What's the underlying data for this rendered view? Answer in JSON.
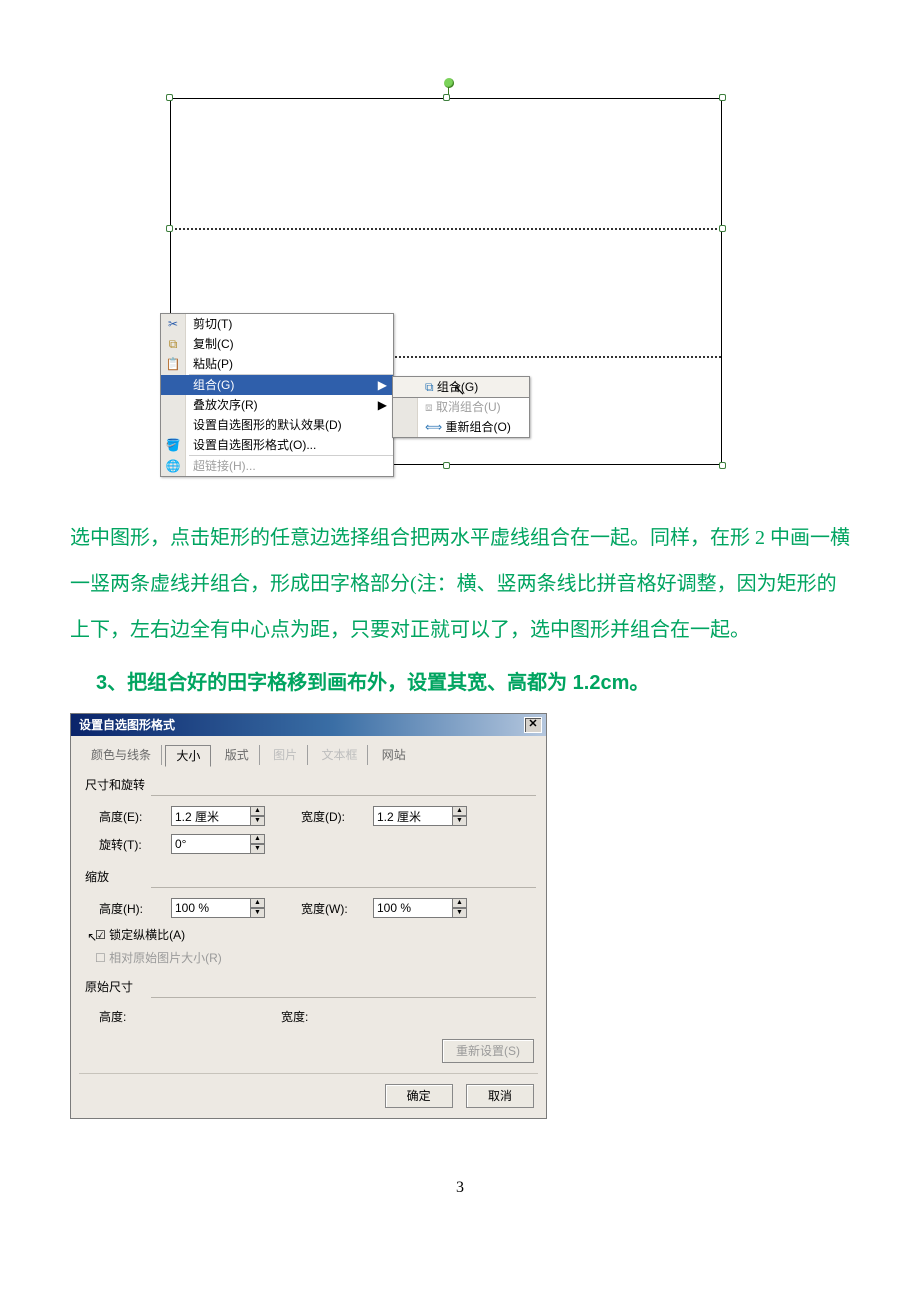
{
  "context_menu": {
    "cut": "剪切(T)",
    "copy": "复制(C)",
    "paste": "粘贴(P)",
    "group": "组合(G)",
    "order": "叠放次序(R)",
    "set_default": "设置自选图形的默认效果(D)",
    "format_shape": "设置自选图形格式(O)...",
    "hyperlink": "超链接(H)..."
  },
  "submenu": {
    "group": "组合(G)",
    "ungroup": "取消组合(U)",
    "regroup": "重新组合(O)"
  },
  "body": {
    "p1": "选中图形，点击矩形的任意边选择组合把两水平虚线组合在一起。同样，在形 2 中画一横一竖两条虚线并组合，形成田字格部分(注：横、竖两条线比拼音格好调整，因为矩形的上下，左右边全有中心点为距，只要对正就可以了，选中图形并组合在一起。",
    "step3": "3、把组合好的田字格移到画布外，设置其宽、高都为 1.2cm。"
  },
  "dialog": {
    "title": "设置自选图形格式",
    "tabs": {
      "color": "颜色与线条",
      "size": "大小",
      "layout": "版式",
      "picture": "图片",
      "textbox": "文本框",
      "web": "网站"
    },
    "sections": {
      "size_rotate": "尺寸和旋转",
      "scale": "缩放",
      "original": "原始尺寸"
    },
    "labels": {
      "height_e": "高度(E):",
      "width_d": "宽度(D):",
      "rotate_t": "旋转(T):",
      "height_h": "高度(H):",
      "width_w": "宽度(W):",
      "height": "高度:",
      "width": "宽度:",
      "lock_aspect": "锁定纵横比(A)",
      "relative_original": "相对原始图片大小(R)"
    },
    "values": {
      "height_e": "1.2 厘米",
      "width_d": "1.2 厘米",
      "rotate": "0°",
      "scale_h": "100 %",
      "scale_w": "100 %"
    },
    "buttons": {
      "reset": "重新设置(S)",
      "ok": "确定",
      "cancel": "取消"
    }
  },
  "page_number": "3"
}
